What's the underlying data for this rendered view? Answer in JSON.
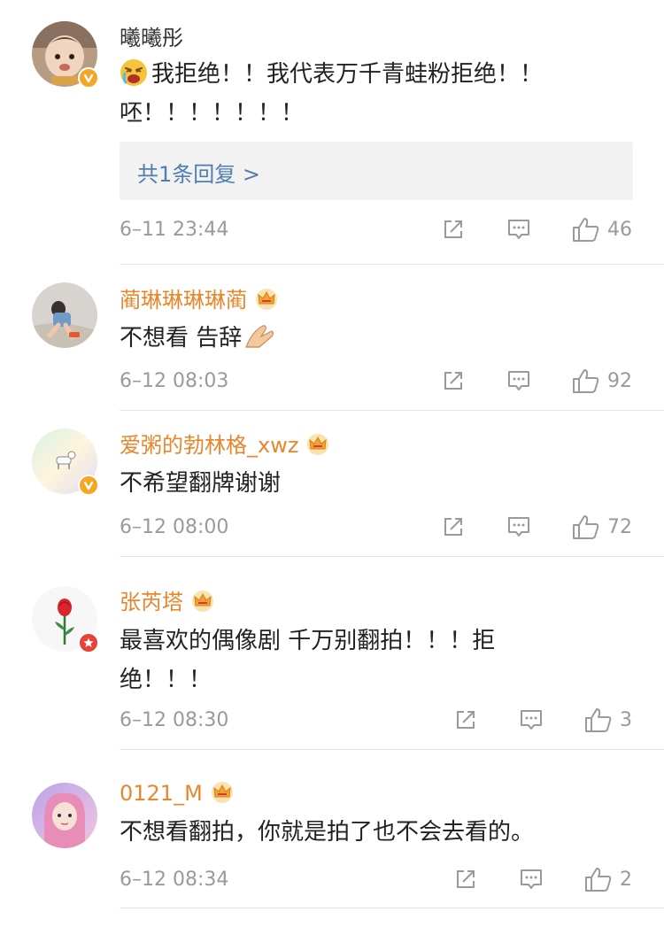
{
  "comments": [
    {
      "username": "曦曦彤",
      "text": "我拒绝！！我代表万千青蛙粉拒绝！！呸！！！！！！！",
      "emoji_icon": "crying-angry-emoji-icon",
      "replies_label": "共1条回复 >",
      "time": "6–11 23:44",
      "likes": "46",
      "badge_icon": "verified-v-icon",
      "vip": false
    },
    {
      "username": "蔺琳琳琳琳蔺",
      "text": "不想看 告辞",
      "emoji_icon": "bye-hand-emoji-icon",
      "time": "6–12 08:03",
      "likes": "92",
      "vip": true
    },
    {
      "username": "爱粥的勃林格_xwz",
      "text": "不希望翻牌谢谢",
      "time": "6–12 08:00",
      "likes": "72",
      "badge_icon": "verified-v-icon",
      "vip": true
    },
    {
      "username": "张芮塔",
      "text": "最喜欢的偶像剧 千万别翻拍！！！拒绝！！！",
      "time": "6–12 08:30",
      "likes": "3",
      "badge_icon": "red-star-badge-icon",
      "vip": true
    },
    {
      "username": "0121_M",
      "text": "不想看翻拍，你就是拍了也不会去看的。",
      "time": "6–12 08:34",
      "likes": "2",
      "vip": true
    }
  ],
  "colors": {
    "vip_name": "#e8862c",
    "link_blue": "#507daf",
    "meta_gray": "#9a9a9a",
    "verified_orange": "#f6a623"
  }
}
